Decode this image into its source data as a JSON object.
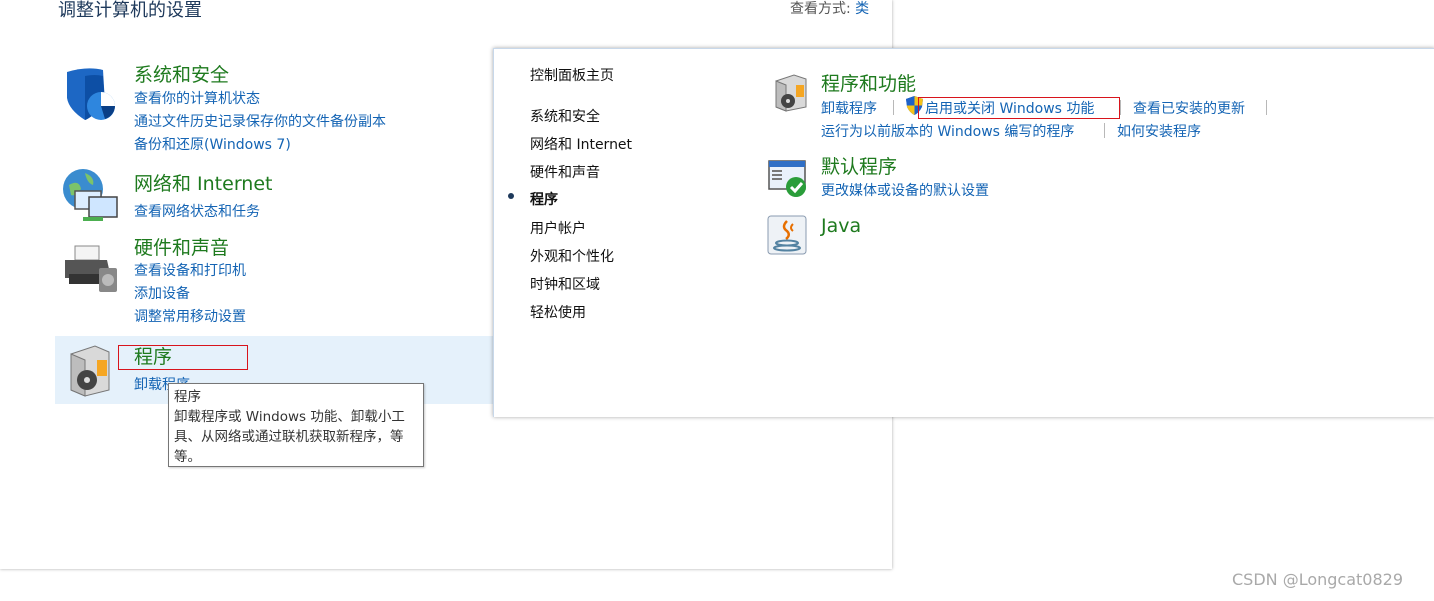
{
  "background_window": {
    "title": "调整计算机的设置",
    "view_by_label": "查看方式:",
    "view_by_value": "类",
    "categories": {
      "system_security": {
        "title": "系统和安全",
        "links": [
          "查看你的计算机状态",
          "通过文件历史记录保存你的文件备份副本",
          "备份和还原(Windows 7)"
        ]
      },
      "network": {
        "title": "网络和 Internet",
        "links": [
          "查看网络状态和任务"
        ]
      },
      "hardware": {
        "title": "硬件和声音",
        "links": [
          "查看设备和打印机",
          "添加设备",
          "调整常用移动设置"
        ]
      },
      "programs": {
        "title": "程序",
        "links": [
          "卸载程序"
        ]
      }
    },
    "tooltip": {
      "title": "程序",
      "body": "卸载程序或 Windows 功能、卸载小工具、从网络或通过联机获取新程序，等等。"
    }
  },
  "foreground_window": {
    "nav": {
      "home": "控制面板主页",
      "items": [
        "系统和安全",
        "网络和 Internet",
        "硬件和声音",
        "程序",
        "用户帐户",
        "外观和个性化",
        "时钟和区域",
        "轻松使用"
      ],
      "active_index": 3
    },
    "sections": {
      "programs_features": {
        "title": "程序和功能",
        "links": [
          "卸载程序",
          "启用或关闭 Windows 功能",
          "查看已安装的更新",
          "运行为以前版本的 Windows 编写的程序",
          "如何安装程序"
        ]
      },
      "default_programs": {
        "title": "默认程序",
        "links": [
          "更改媒体或设备的默认设置"
        ]
      },
      "java": {
        "title": "Java"
      }
    }
  },
  "watermark": "CSDN @Longcat0829",
  "colors": {
    "category_title": "#1e7a1e",
    "link": "#1464b4",
    "highlight_bg": "#e5f1fb",
    "annotation_red": "#d8141c"
  }
}
